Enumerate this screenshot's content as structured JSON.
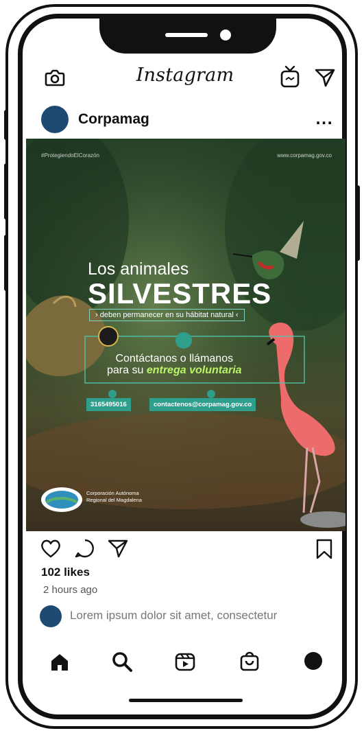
{
  "app": {
    "title": "Instagram"
  },
  "post": {
    "username": "Corpamag",
    "more_label": "...",
    "likes": "102 likes",
    "time_ago": "2 hours ago",
    "comment_placeholder": "Lorem ipsum dolor sit amet, consectetur",
    "image": {
      "hashtag": "#ProtegiendoElCorazón",
      "handle": "www.corpamag.gov.co",
      "line1": "Los animales",
      "line2": "SILVESTRES",
      "line3": "› deben permanecer en su hábitat natural ‹",
      "line4a": "Contáctanos o llámanos",
      "line4b_prefix": "para su",
      "line4b_emphasis": "entrega voluntaria",
      "phone": "3165495016",
      "email": "contactenos@corpamag.gov.co",
      "org_line1": "Corporación Autónoma",
      "org_line2": "Regional del Magdalena"
    }
  },
  "icons": {
    "camera": "camera-icon",
    "igtv": "igtv-icon",
    "direct": "direct-message-icon",
    "like": "heart-icon",
    "comment": "comment-icon",
    "share": "share-icon",
    "save": "bookmark-icon",
    "home": "home-icon",
    "search": "search-icon",
    "reels": "reels-icon",
    "shop": "shop-icon",
    "profile": "profile-icon"
  },
  "colors": {
    "avatar": "#1e4a72",
    "frame": "#111111",
    "accent_teal": "#2f9e8a",
    "accent_green": "#b9f56a"
  }
}
